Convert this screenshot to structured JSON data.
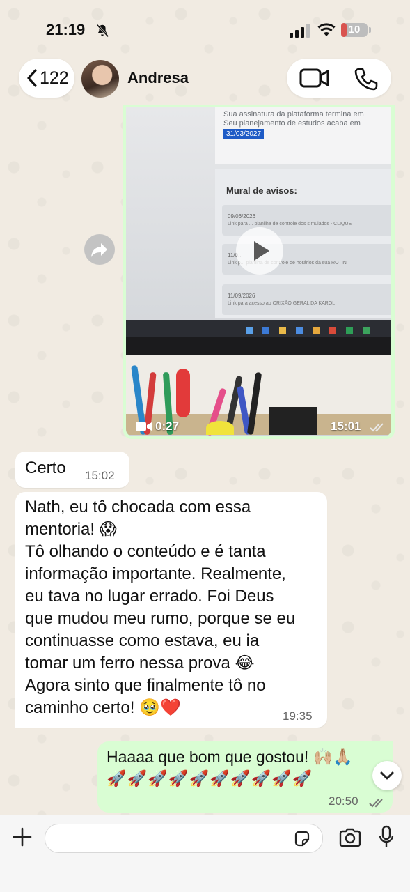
{
  "status": {
    "time": "21:19",
    "battery": "10",
    "battery_level": 0.1
  },
  "header": {
    "back_count": "122",
    "contact_name": "Andresa"
  },
  "video_message": {
    "screen": {
      "line1": "Sua assinatura da plataforma termina em",
      "line2": "Seu planejamento de estudos acaba em",
      "date_badge": "31/03/2027",
      "mural_title": "Mural de avisos:",
      "notices": [
        {
          "date": "09/06/2026",
          "text": "Link para ... planilha de controle dos simulados - CLIQUE"
        },
        {
          "date": "11/0...",
          "text": "Link p... planilha de controle de horários da sua ROTIN"
        },
        {
          "date": "11/09/2026",
          "text": "Link para acesso ao ORIXÃO GERAL DA KAROL"
        }
      ]
    },
    "duration": "0:27",
    "time": "15:01"
  },
  "messages": [
    {
      "text": "Certo",
      "time": "15:02"
    },
    {
      "lines": [
        "Nath, eu tô chocada com essa",
        "mentoria! 😱",
        "Tô olhando o conteúdo e é tanta",
        "informação importante. Realmente,",
        "eu tava no lugar errado. Foi Deus",
        "que mudou meu rumo, porque se eu",
        "continuasse como estava, eu ia",
        "tomar um ferro nessa prova 😂",
        "Agora sinto que finalmente tô no",
        "caminho certo! 🥹❤️"
      ],
      "time": "19:35"
    }
  ],
  "outgoing": {
    "line1": "Haaaa que bom que gostou! 🙌🏼🙏🏼",
    "line2": "🚀🚀🚀🚀🚀🚀🚀🚀🚀🚀",
    "time": "20:50"
  }
}
